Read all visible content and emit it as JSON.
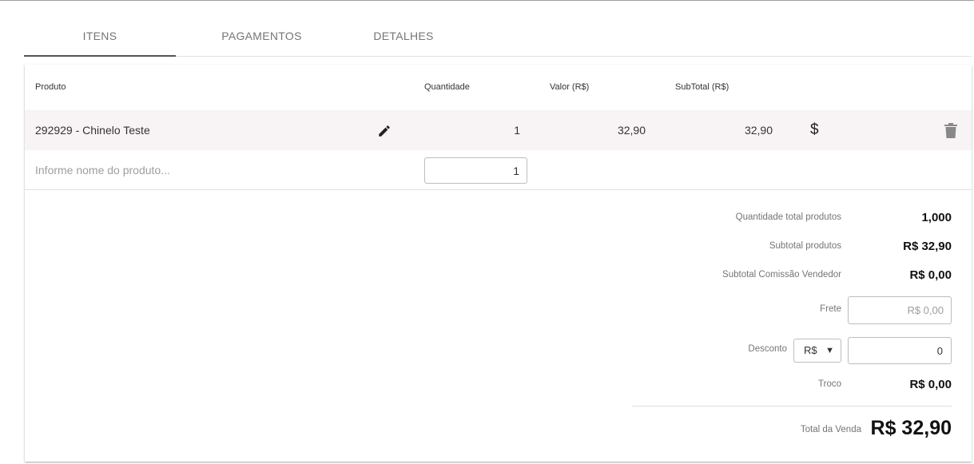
{
  "tabs": [
    {
      "label": "ITENS",
      "active": true
    },
    {
      "label": "PAGAMENTOS",
      "active": false
    },
    {
      "label": "DETALHES",
      "active": false
    }
  ],
  "table": {
    "headers": {
      "produto": "Produto",
      "quantidade": "Quantidade",
      "valor": "Valor (R$)",
      "subtotal": "SubTotal (R$)"
    },
    "rows": [
      {
        "produto": "292929 - Chinelo Teste",
        "quantidade": "1",
        "valor": "32,90",
        "subtotal": "32,90"
      }
    ],
    "row_icons": [
      "pencil-icon",
      "dollar-icon",
      "trash-icon"
    ],
    "new_item": {
      "product_placeholder": "Informe nome do produto...",
      "quantity_value": "1"
    }
  },
  "summary": {
    "qtd_total_label": "Quantidade total produtos",
    "qtd_total_value": "1,000",
    "subtotal_label": "Subtotal produtos",
    "subtotal_value": "R$ 32,90",
    "comissao_label": "Subtotal Comissão Vendedor",
    "comissao_value": "R$ 0,00",
    "frete_label": "Frete",
    "frete_placeholder": "R$ 0,00",
    "desconto_label": "Desconto",
    "desconto_type": "R$",
    "desconto_value": "0",
    "troco_label": "Troco",
    "troco_value": "R$ 0,00",
    "total_label": "Total da Venda",
    "total_value": "R$ 32,90"
  },
  "colors": {
    "row_highlight": "#f8f3f5",
    "tab_indicator": "#555555"
  }
}
